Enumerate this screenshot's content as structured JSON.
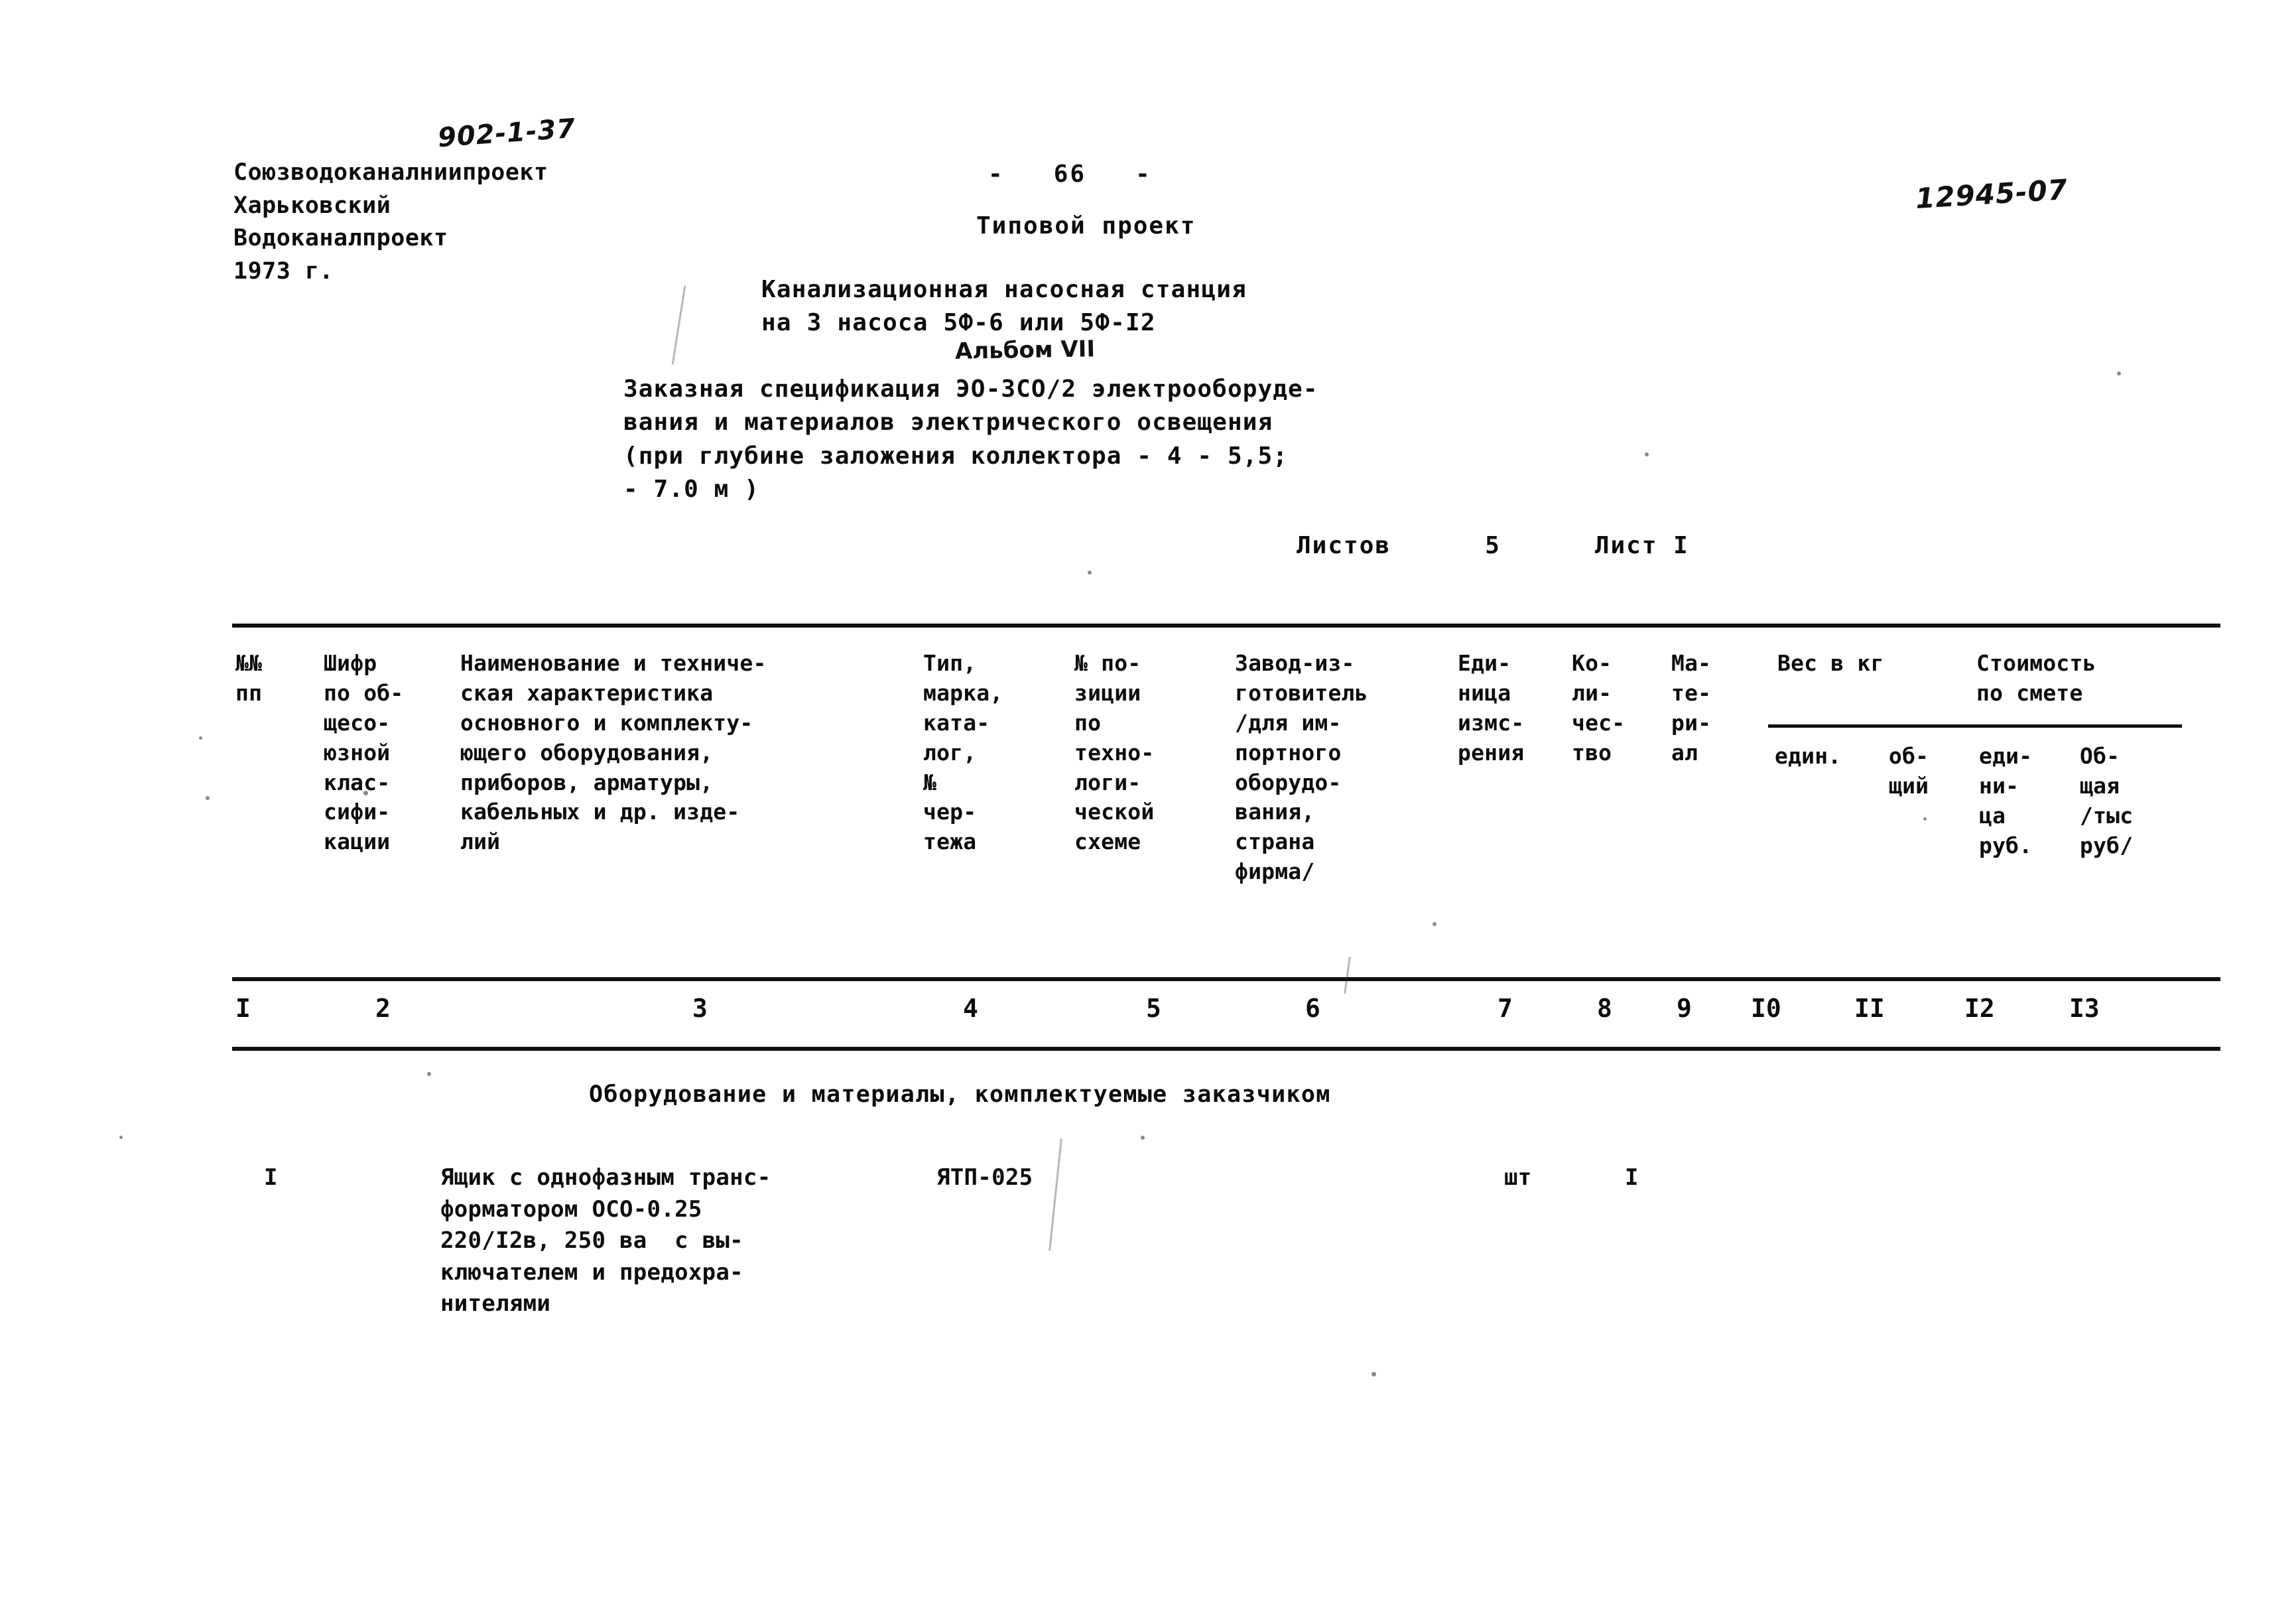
{
  "header": {
    "project_code_handwritten": "902-1-37",
    "organization_lines": [
      "Союзводоканалниипроект",
      "Харьковский",
      "Водоканалпроект",
      "1973 г."
    ],
    "right_code_handwritten": "12945-07",
    "page_number": "-   66   -",
    "document_kind": "Типовой проект",
    "object_title_lines": [
      "Канализационная насосная станция",
      "на 3 насоса 5Ф-6 или 5Ф-I2"
    ],
    "album_handwritten": "Альбом VII",
    "spec_title_lines": [
      "Заказная спецификация ЭО-ЗСО/2 электрообору­де-",
      "вания и материалов электрического освещения",
      "(при глубине заложения коллектора - 4 - 5,5;",
      "- 7.0 м )"
    ],
    "sheets_line": "Листов      5      Лист I"
  },
  "table": {
    "headers": {
      "col1": "№№\nпп",
      "col2": "Шифр\nпо об-\nщесо-\nюзной\nклас-\nсифи-\nкации",
      "col3": "Наименование и техниче-\nская характеристика\nосновного и комплекту-\nющего оборудования,\nприборов, арматуры,\nкабельных и др. изде-\nлий",
      "col4": "Тип,\nмарка,\nката-\nлог,\n№\nчер-\nтежа",
      "col5": "№ по-\nзиции\nпо\nтехно-\nлоги-\nческой\nсхеме",
      "col6": "Завод-из-\nготовитель\n/для им-\nпортного\nоборудо-\nвания,\nстрана\nфирма/",
      "col7": "Еди-\nница\nизмс-\nрения",
      "col8": "Ко-\nли-\nчес-\nтво",
      "col9": "Ма-\nте-\nри-\nал",
      "group_weight": "Вес в кг",
      "group_cost": "Стоимость\nпо смете",
      "col10": "един.",
      "col11": "об-\nщий",
      "col12": "еди-\nни-\nца\nруб.",
      "col13": "Об-\nщая\n/тыс\nруб/"
    },
    "column_numbers": [
      "I",
      "2",
      "3",
      "4",
      "5",
      "6",
      "7",
      "8",
      "9",
      "I0",
      "II",
      "I2",
      "I3"
    ],
    "section_title": "Оборудование и материалы, комплектуемые заказчиком",
    "rows": [
      {
        "num": "I",
        "code": "",
        "name": "Ящик с однофазным транс-\nформатором ОСО-0.25\n220/I2в, 250 ва  с вы-\nключателем и предохра-\nнителями",
        "type": "ЯТП-025",
        "position": "",
        "manufacturer": "",
        "unit": "шт",
        "qty": "I",
        "material": "",
        "weight_unit": "",
        "weight_total": "",
        "cost_unit": "",
        "cost_total": ""
      }
    ]
  }
}
